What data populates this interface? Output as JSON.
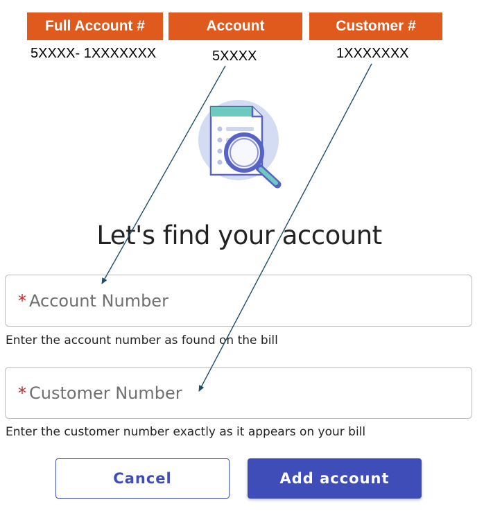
{
  "legend": {
    "full_account_label": "Full Account #",
    "account_label": "Account",
    "customer_label": "Customer #",
    "full_account_value": "5XXXX- 1XXXXXXX",
    "account_value": "5XXXX",
    "customer_value": "1XXXXXXX"
  },
  "form": {
    "title": "Let's find your account",
    "required_marker": "*",
    "account_number": {
      "placeholder": "Account Number",
      "helper": "Enter the account number as found on the bill"
    },
    "customer_number": {
      "placeholder": "Customer Number",
      "helper": "Enter the customer number exactly as it appears on your bill"
    }
  },
  "buttons": {
    "cancel_label": "Cancel",
    "add_label": "Add account"
  },
  "icons": {
    "illustration": "document-search-icon",
    "arrows": "annotation-arrow-icon"
  },
  "colors": {
    "header_orange": "#e05a1e",
    "button_blue": "#3f4db8",
    "required_red": "#c62828",
    "arrow": "#1d4e6b",
    "illus_circle": "#d4dcf4"
  }
}
